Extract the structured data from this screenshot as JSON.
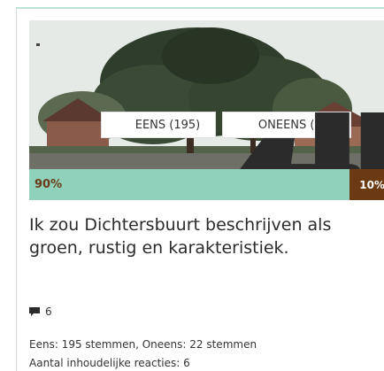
{
  "colors": {
    "agree_bar": "#8fd1bb",
    "disagree_bar": "#6a3a12",
    "agree_percent_text": "#6b3c1a",
    "accent": "#b9e3d3"
  },
  "vote": {
    "agree_label": "EENS (195)",
    "disagree_label": "ONEENS (22)",
    "agree_icon": "thumbs-up-icon",
    "disagree_icon": "thumbs-down-icon"
  },
  "result": {
    "agree_percent": "90%",
    "disagree_percent": "10%",
    "agree_fraction": 0.9
  },
  "statement": "Ik zou Dichtersbuurt beschrijven als groen, rustig en karakteristiek.",
  "reactions": {
    "icon": "comment-icon",
    "count": "6"
  },
  "meta": {
    "votes_summary": "Eens: 195 stemmen, Oneens: 22 stemmen",
    "comments_summary": "Aantal inhoudelijke reacties: 6"
  }
}
